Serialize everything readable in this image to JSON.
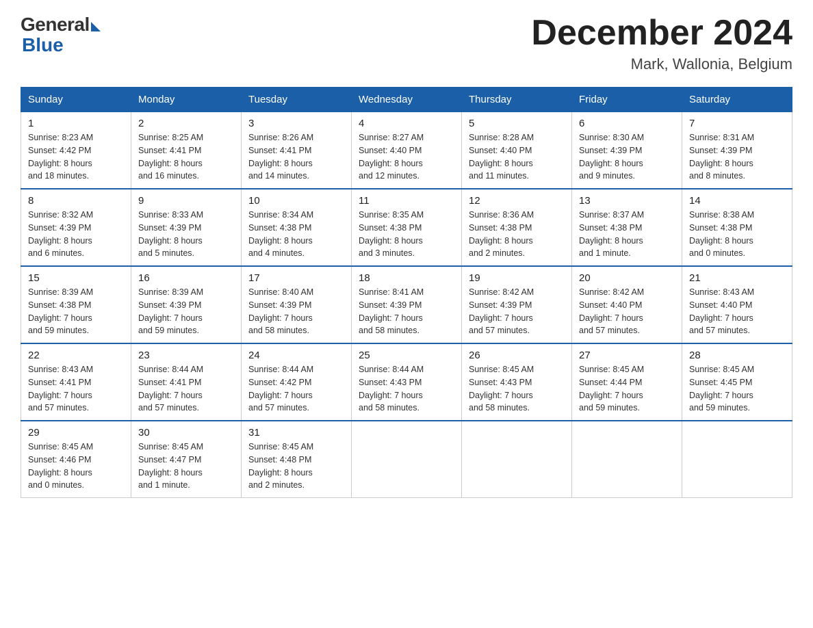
{
  "logo": {
    "general": "General",
    "blue": "Blue"
  },
  "title": {
    "month": "December 2024",
    "location": "Mark, Wallonia, Belgium"
  },
  "weekdays": [
    "Sunday",
    "Monday",
    "Tuesday",
    "Wednesday",
    "Thursday",
    "Friday",
    "Saturday"
  ],
  "weeks": [
    [
      {
        "day": "1",
        "info": "Sunrise: 8:23 AM\nSunset: 4:42 PM\nDaylight: 8 hours\nand 18 minutes."
      },
      {
        "day": "2",
        "info": "Sunrise: 8:25 AM\nSunset: 4:41 PM\nDaylight: 8 hours\nand 16 minutes."
      },
      {
        "day": "3",
        "info": "Sunrise: 8:26 AM\nSunset: 4:41 PM\nDaylight: 8 hours\nand 14 minutes."
      },
      {
        "day": "4",
        "info": "Sunrise: 8:27 AM\nSunset: 4:40 PM\nDaylight: 8 hours\nand 12 minutes."
      },
      {
        "day": "5",
        "info": "Sunrise: 8:28 AM\nSunset: 4:40 PM\nDaylight: 8 hours\nand 11 minutes."
      },
      {
        "day": "6",
        "info": "Sunrise: 8:30 AM\nSunset: 4:39 PM\nDaylight: 8 hours\nand 9 minutes."
      },
      {
        "day": "7",
        "info": "Sunrise: 8:31 AM\nSunset: 4:39 PM\nDaylight: 8 hours\nand 8 minutes."
      }
    ],
    [
      {
        "day": "8",
        "info": "Sunrise: 8:32 AM\nSunset: 4:39 PM\nDaylight: 8 hours\nand 6 minutes."
      },
      {
        "day": "9",
        "info": "Sunrise: 8:33 AM\nSunset: 4:39 PM\nDaylight: 8 hours\nand 5 minutes."
      },
      {
        "day": "10",
        "info": "Sunrise: 8:34 AM\nSunset: 4:38 PM\nDaylight: 8 hours\nand 4 minutes."
      },
      {
        "day": "11",
        "info": "Sunrise: 8:35 AM\nSunset: 4:38 PM\nDaylight: 8 hours\nand 3 minutes."
      },
      {
        "day": "12",
        "info": "Sunrise: 8:36 AM\nSunset: 4:38 PM\nDaylight: 8 hours\nand 2 minutes."
      },
      {
        "day": "13",
        "info": "Sunrise: 8:37 AM\nSunset: 4:38 PM\nDaylight: 8 hours\nand 1 minute."
      },
      {
        "day": "14",
        "info": "Sunrise: 8:38 AM\nSunset: 4:38 PM\nDaylight: 8 hours\nand 0 minutes."
      }
    ],
    [
      {
        "day": "15",
        "info": "Sunrise: 8:39 AM\nSunset: 4:38 PM\nDaylight: 7 hours\nand 59 minutes."
      },
      {
        "day": "16",
        "info": "Sunrise: 8:39 AM\nSunset: 4:39 PM\nDaylight: 7 hours\nand 59 minutes."
      },
      {
        "day": "17",
        "info": "Sunrise: 8:40 AM\nSunset: 4:39 PM\nDaylight: 7 hours\nand 58 minutes."
      },
      {
        "day": "18",
        "info": "Sunrise: 8:41 AM\nSunset: 4:39 PM\nDaylight: 7 hours\nand 58 minutes."
      },
      {
        "day": "19",
        "info": "Sunrise: 8:42 AM\nSunset: 4:39 PM\nDaylight: 7 hours\nand 57 minutes."
      },
      {
        "day": "20",
        "info": "Sunrise: 8:42 AM\nSunset: 4:40 PM\nDaylight: 7 hours\nand 57 minutes."
      },
      {
        "day": "21",
        "info": "Sunrise: 8:43 AM\nSunset: 4:40 PM\nDaylight: 7 hours\nand 57 minutes."
      }
    ],
    [
      {
        "day": "22",
        "info": "Sunrise: 8:43 AM\nSunset: 4:41 PM\nDaylight: 7 hours\nand 57 minutes."
      },
      {
        "day": "23",
        "info": "Sunrise: 8:44 AM\nSunset: 4:41 PM\nDaylight: 7 hours\nand 57 minutes."
      },
      {
        "day": "24",
        "info": "Sunrise: 8:44 AM\nSunset: 4:42 PM\nDaylight: 7 hours\nand 57 minutes."
      },
      {
        "day": "25",
        "info": "Sunrise: 8:44 AM\nSunset: 4:43 PM\nDaylight: 7 hours\nand 58 minutes."
      },
      {
        "day": "26",
        "info": "Sunrise: 8:45 AM\nSunset: 4:43 PM\nDaylight: 7 hours\nand 58 minutes."
      },
      {
        "day": "27",
        "info": "Sunrise: 8:45 AM\nSunset: 4:44 PM\nDaylight: 7 hours\nand 59 minutes."
      },
      {
        "day": "28",
        "info": "Sunrise: 8:45 AM\nSunset: 4:45 PM\nDaylight: 7 hours\nand 59 minutes."
      }
    ],
    [
      {
        "day": "29",
        "info": "Sunrise: 8:45 AM\nSunset: 4:46 PM\nDaylight: 8 hours\nand 0 minutes."
      },
      {
        "day": "30",
        "info": "Sunrise: 8:45 AM\nSunset: 4:47 PM\nDaylight: 8 hours\nand 1 minute."
      },
      {
        "day": "31",
        "info": "Sunrise: 8:45 AM\nSunset: 4:48 PM\nDaylight: 8 hours\nand 2 minutes."
      },
      null,
      null,
      null,
      null
    ]
  ]
}
